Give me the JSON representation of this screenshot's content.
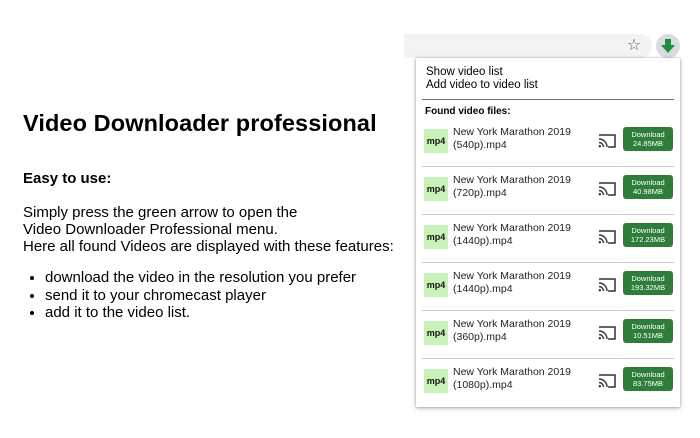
{
  "promo": {
    "title": "Video Downloader professional",
    "subhead": "Easy to use:",
    "desc_line1": "Simply press the green arrow to open the",
    "desc_line2": "Video Downloader Professional menu.",
    "desc_line3": "Here all found Videos are displayed with these features:",
    "features": [
      "download the video in the resolution you prefer",
      "send it to your chromecast player",
      "add it to the video list."
    ]
  },
  "toolbar": {
    "star_icon": "star-icon",
    "extension_icon": "green-down-arrow-icon",
    "accent_color": "#1e8e3e"
  },
  "popup": {
    "menu": {
      "show_list": "Show video list",
      "add_list": "Add video to video list"
    },
    "found_label": "Found video files:",
    "videos": [
      {
        "format": "mp4",
        "title_line1": "New York Marathon 2019",
        "title_line2": "(540p).mp4",
        "button_line1": "Download",
        "button_line2": "24.85MB"
      },
      {
        "format": "mp4",
        "title_line1": "New York Marathon 2019",
        "title_line2": "(720p).mp4",
        "button_line1": "Download",
        "button_line2": "40.98MB"
      },
      {
        "format": "mp4",
        "title_line1": "New York Marathon 2019",
        "title_line2": "(1440p).mp4",
        "button_line1": "Download",
        "button_line2": "172.23MB"
      },
      {
        "format": "mp4",
        "title_line1": "New York Marathon 2019",
        "title_line2": "(1440p).mp4",
        "button_line1": "Download",
        "button_line2": "193.32MB"
      },
      {
        "format": "mp4",
        "title_line1": "New York Marathon 2019",
        "title_line2": "(360p).mp4",
        "button_line1": "Download",
        "button_line2": "10.51MB"
      },
      {
        "format": "mp4",
        "title_line1": "New York Marathon 2019",
        "title_line2": "(1080p).mp4",
        "button_line1": "Download",
        "button_line2": "83.75MB"
      }
    ],
    "download_color": "#2f7d3a",
    "badge_color": "#c9f2b9"
  }
}
